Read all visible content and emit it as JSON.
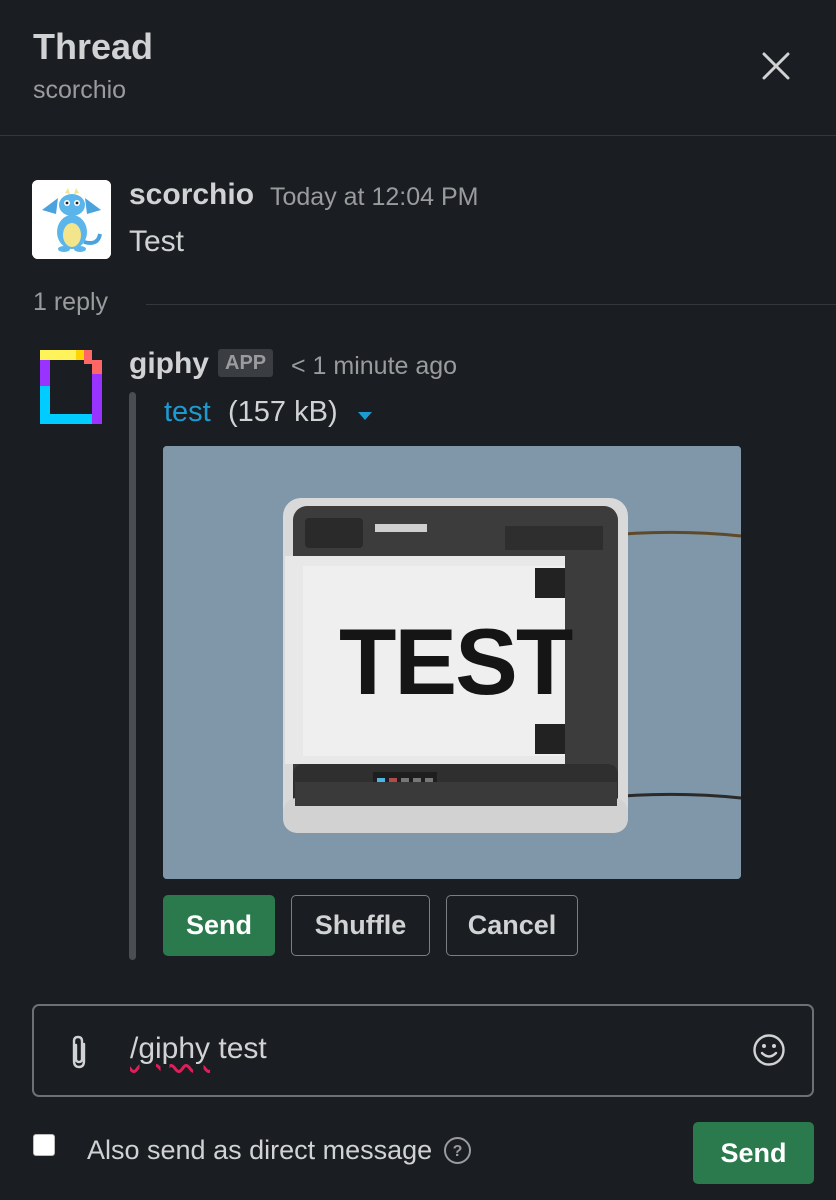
{
  "header": {
    "title": "Thread",
    "channel": "scorchio",
    "close_icon": "close-icon"
  },
  "parent_message": {
    "author": "scorchio",
    "timestamp": "Today at 12:04 PM",
    "text": "Test",
    "avatar_icon": "dragon-avatar"
  },
  "thread": {
    "reply_count": "1 reply"
  },
  "giphy_message": {
    "author": "giphy",
    "badge": "APP",
    "time": "< 1 minute ago",
    "file_name": "test",
    "file_size": "(157 kB)",
    "caret_icon": "caret-down-icon",
    "gif_text": "TEST",
    "accent": "#1d9bd1",
    "buttons": {
      "send": "Send",
      "shuffle": "Shuffle",
      "cancel": "Cancel"
    }
  },
  "composer": {
    "command": "/giphy",
    "query": " test",
    "attach_icon": "paperclip-icon",
    "emoji_icon": "emoji-icon"
  },
  "footer": {
    "also_send_label": "Also send as direct message",
    "help_icon": "help-icon",
    "send_label": "Send",
    "send_color": "#2b7a4d"
  }
}
